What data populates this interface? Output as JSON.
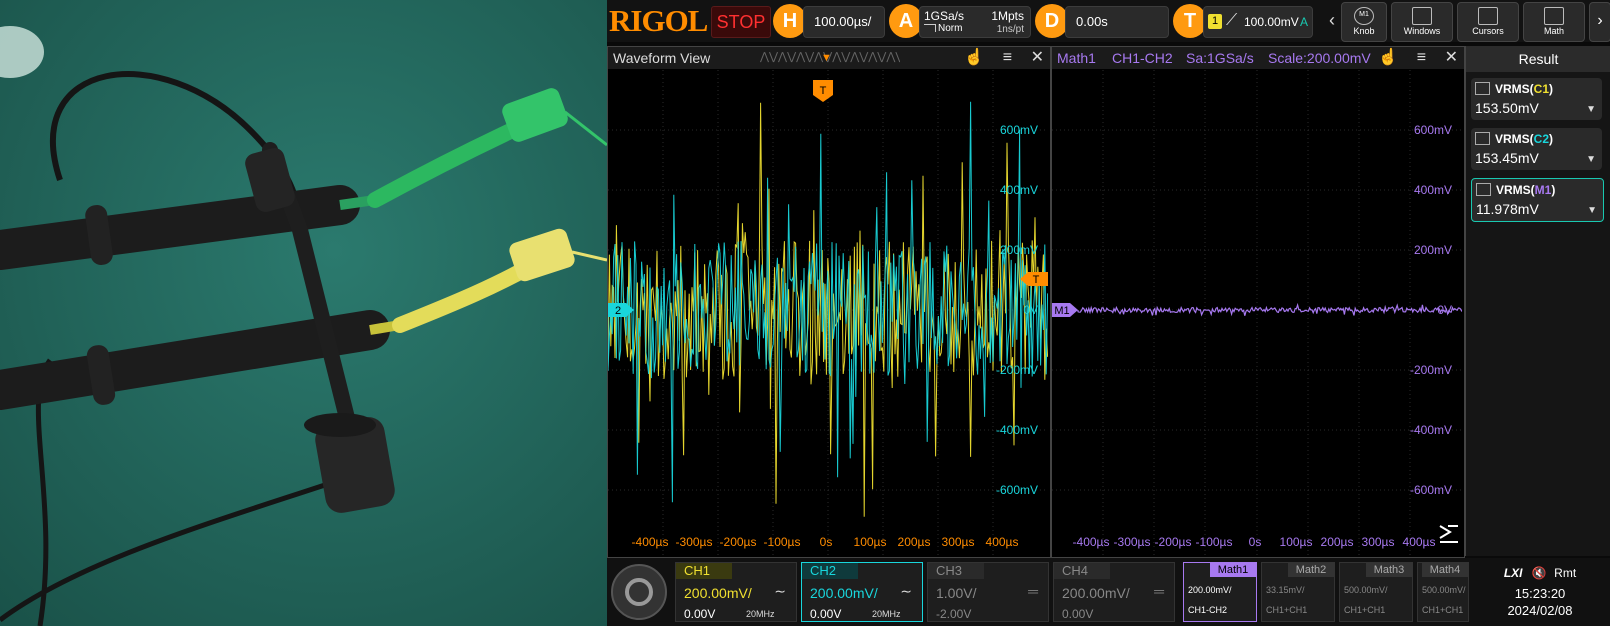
{
  "topbar": {
    "brand": "RIGOL",
    "run_state": "STOP",
    "horizontal": {
      "badge": "H",
      "value": "100.00µs/"
    },
    "acquire": {
      "badge": "A",
      "sample_rate": "1GSa/s",
      "mode": "Norm",
      "memory_depth": "1Mpts",
      "time_per_point": "1ns/pt"
    },
    "delay": {
      "badge": "D",
      "value": "0.00s"
    },
    "trigger": {
      "badge": "T",
      "source": "1",
      "level": "100.00mV",
      "mode": "A"
    },
    "buttons": [
      {
        "label": "Knob"
      },
      {
        "label": "Windows"
      },
      {
        "label": "Cursors"
      },
      {
        "label": "Math"
      }
    ],
    "knob_tag": "M1"
  },
  "waveform_view": {
    "title": "Waveform View",
    "trigger_marker": "T",
    "channel_marker": "2",
    "y_ticks": [
      "600mV",
      "400mV",
      "200mV",
      "0V",
      "-200mV",
      "-400mV",
      "-600mV"
    ],
    "x_ticks": [
      "-400µs",
      "-300µs",
      "-200µs",
      "-100µs",
      "0s",
      "100µs",
      "200µs",
      "300µs",
      "400µs"
    ]
  },
  "math_view": {
    "title": "Math1",
    "expression": "CH1-CH2",
    "sample_rate": "Sa:1GSa/s",
    "scale": "Scale:200.00mV",
    "marker": "M1",
    "y_ticks": [
      "600mV",
      "400mV",
      "200mV",
      "0V",
      "-200mV",
      "-400mV",
      "-600mV"
    ],
    "x_ticks": [
      "-400µs",
      "-300µs",
      "-200µs",
      "-100µs",
      "0s",
      "100µs",
      "200µs",
      "300µs",
      "400µs"
    ]
  },
  "result": {
    "title": "Result",
    "items": [
      {
        "name_prefix": "VRMS(",
        "source": "C1",
        "name_suffix": ")",
        "value": "153.50mV",
        "color": "#f0e030"
      },
      {
        "name_prefix": "VRMS(",
        "source": "C2",
        "name_suffix": ")",
        "value": "153.45mV",
        "color": "#19d6dc"
      },
      {
        "name_prefix": "VRMS(",
        "source": "M1",
        "name_suffix": ")",
        "value": "11.978mV",
        "color": "#a779f0"
      }
    ]
  },
  "channels": [
    {
      "name": "CH1",
      "scale": "200.00mV/",
      "offset": "0.00V",
      "bandwidth": "20MHz",
      "color": "#f0e030",
      "active": true
    },
    {
      "name": "CH2",
      "scale": "200.00mV/",
      "offset": "0.00V",
      "bandwidth": "20MHz",
      "color": "#19d6dc",
      "active": true
    },
    {
      "name": "CH3",
      "scale": "1.00V/",
      "offset": "-2.00V",
      "bandwidth": "",
      "color": "#888888",
      "active": false
    },
    {
      "name": "CH4",
      "scale": "200.00mV/",
      "offset": "0.00V",
      "bandwidth": "",
      "color": "#888888",
      "active": false
    }
  ],
  "maths": [
    {
      "name": "Math1",
      "scale": "200.00mV/",
      "expr": "CH1-CH2",
      "active": true
    },
    {
      "name": "Math2",
      "scale": "33.15mV/",
      "expr": "CH1+CH1",
      "active": false
    },
    {
      "name": "Math3",
      "scale": "500.00mV/",
      "expr": "CH1+CH1",
      "active": false
    },
    {
      "name": "Math4",
      "scale": "500.00mV/",
      "expr": "CH1+CH1",
      "active": false
    }
  ],
  "status": {
    "lxi": "LXI",
    "remote": "Rmt",
    "time": "15:23:20",
    "date": "2024/02/08"
  },
  "colors": {
    "ch1": "#f0e030",
    "ch2": "#19d6dc",
    "math": "#a779f0",
    "trigger": "#ff8c00",
    "accent": "#19c8b0"
  }
}
